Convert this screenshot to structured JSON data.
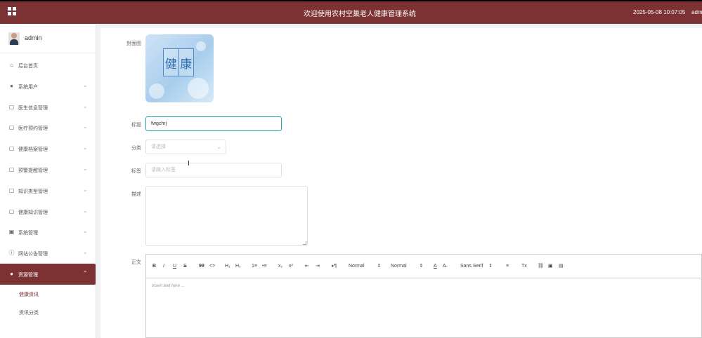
{
  "header": {
    "title": "欢迎使用农村空巢老人健康管理系统",
    "datetime": "2025-05-08 10:07:05",
    "user": "adm"
  },
  "sidebar": {
    "username": "admin",
    "items": [
      {
        "label": "后台首页",
        "icon": "home-icon"
      },
      {
        "label": "系统用户",
        "icon": "user-icon"
      },
      {
        "label": "医生信息管理",
        "icon": "doc-icon"
      },
      {
        "label": "医疗预约管理",
        "icon": "doc-icon"
      },
      {
        "label": "健康档案管理",
        "icon": "doc-icon"
      },
      {
        "label": "预警提醒管理",
        "icon": "doc-icon"
      },
      {
        "label": "知识类型管理",
        "icon": "doc-icon"
      },
      {
        "label": "健康知识管理",
        "icon": "doc-icon"
      },
      {
        "label": "系统管理",
        "icon": "image-icon"
      },
      {
        "label": "网站公告管理",
        "icon": "info-icon"
      },
      {
        "label": "资源管理",
        "icon": "bulb-icon"
      }
    ],
    "subitems": [
      {
        "label": "健康资讯"
      },
      {
        "label": "资讯分类"
      }
    ]
  },
  "form": {
    "cover_label": "封面图",
    "cover_text": [
      "健",
      "康"
    ],
    "title_label": "标题",
    "title_value": "fwgchrj",
    "category_label": "分类",
    "category_placeholder": "请选择",
    "tags_label": "标签",
    "tags_placeholder": "请输入标签",
    "desc_label": "描述",
    "body_label": "正文",
    "editor_placeholder": "Insert text here ..."
  },
  "editor_toolbar": {
    "bold": "B",
    "italic": "I",
    "underline": "U",
    "strike": "S",
    "quote": "99",
    "code": "<>",
    "h1": "H₁",
    "h2": "H₂",
    "ordered_list": "1≡",
    "bullet_list": "•≡",
    "subscript": "x₂",
    "superscript": "x²",
    "outdent": "⇤",
    "indent": "⇥",
    "rtl": "▸¶",
    "size": "Normal",
    "header": "Normal",
    "color": "A",
    "background": "A̶",
    "font": "Sans Serif",
    "align": "≡",
    "clean": "Tx",
    "link": "🔗",
    "image": "▣",
    "video": "▤"
  },
  "colors": {
    "brand": "#7c3133",
    "focus": "#2ba5ad"
  }
}
